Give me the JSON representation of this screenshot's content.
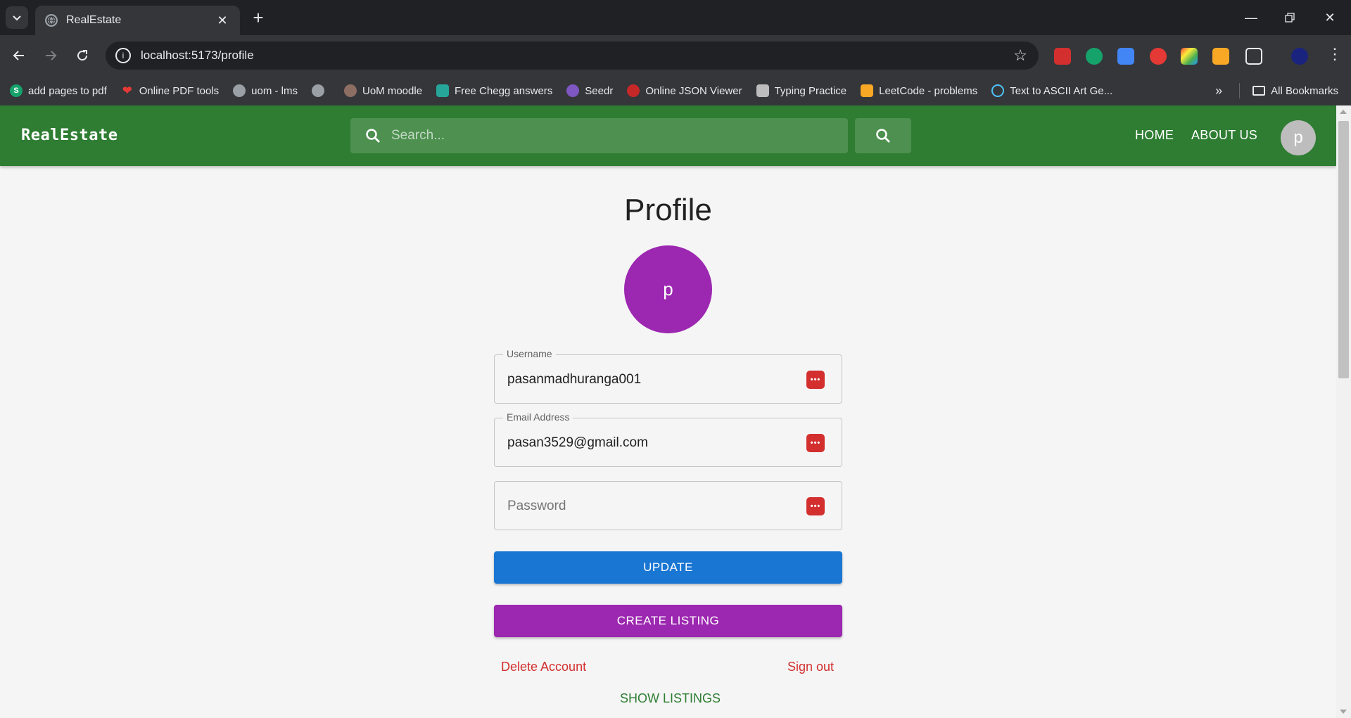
{
  "browser": {
    "tab_title": "RealEstate",
    "url": "localhost:5173/profile",
    "bookmarks": [
      {
        "label": "add pages to pdf",
        "icon": "s-logo-icon",
        "color": "#15a26b"
      },
      {
        "label": "Online PDF tools",
        "icon": "heart-icon",
        "color": "#e53935"
      },
      {
        "label": "uom - lms",
        "icon": "globe-icon",
        "color": "#9aa0a6"
      },
      {
        "label": "",
        "icon": "globe-icon",
        "color": "#9aa0a6"
      },
      {
        "label": "UoM moodle",
        "icon": "moodle-icon",
        "color": "#8d6e63"
      },
      {
        "label": "Free Chegg answers",
        "icon": "books-icon",
        "color": "#26a69a"
      },
      {
        "label": "Seedr",
        "icon": "seed-icon",
        "color": "#7e57c2"
      },
      {
        "label": "Online JSON Viewer",
        "icon": "json-icon",
        "color": "#c62828"
      },
      {
        "label": "Typing Practice",
        "icon": "keyboard-icon",
        "color": "#bdbdbd"
      },
      {
        "label": "LeetCode - problems",
        "icon": "leetcode-icon",
        "color": "#f9a825"
      },
      {
        "label": "Text to ASCII Art Ge...",
        "icon": "react-icon",
        "color": "#4fc3f7"
      }
    ],
    "all_bookmarks": "All Bookmarks"
  },
  "app": {
    "brand": "RealEstate",
    "search_placeholder": "Search...",
    "nav": {
      "home": "HOME",
      "about": "ABOUT US"
    },
    "avatar_initial": "p"
  },
  "profile": {
    "title": "Profile",
    "avatar_initial": "p",
    "username_label": "Username",
    "username_value": "pasanmadhuranga001",
    "email_label": "Email Address",
    "email_value": "pasan3529@gmail.com",
    "password_placeholder": "Password",
    "update_label": "UPDATE",
    "create_listing_label": "CREATE LISTING",
    "delete_account_label": "Delete Account",
    "sign_out_label": "Sign out",
    "show_listings_label": "SHOW LISTINGS"
  },
  "colors": {
    "appbar": "#2e7d32",
    "primary": "#1976d2",
    "secondary": "#9c27b0",
    "danger": "#d32f2f"
  }
}
